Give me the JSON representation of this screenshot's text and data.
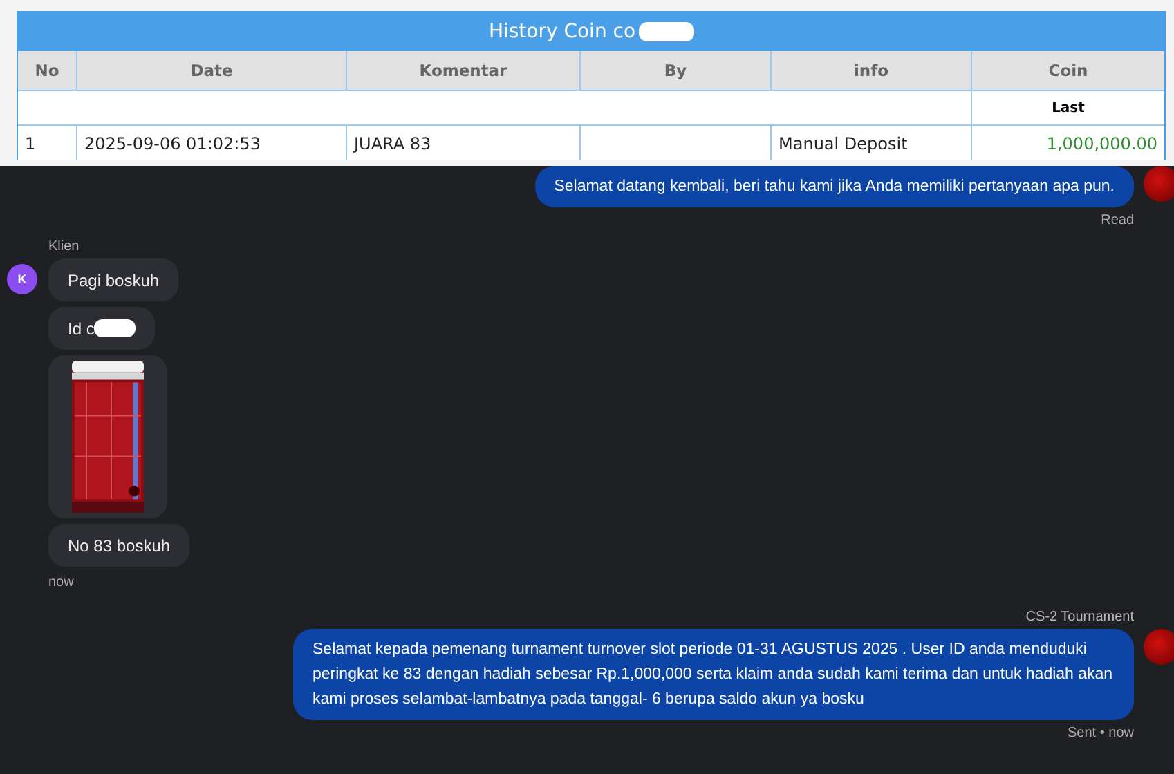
{
  "history": {
    "title": "History Coin co",
    "title_redacted": true,
    "columns": [
      "No",
      "Date",
      "Komentar",
      "By",
      "info",
      "Coin"
    ],
    "subheader": "Last",
    "rows": [
      {
        "no": "1",
        "date": "2025-09-06 01:02:53",
        "komentar": "JUARA 83",
        "info": "Manual Deposit",
        "coin": "1,000,000.00"
      }
    ]
  },
  "chat": [
    {
      "kind": "agent",
      "text": "Selamat datang kembali, beri tahu kami jika Anda memiliki pertanyaan apa pun.",
      "status": "Read"
    },
    {
      "kind": "client",
      "sender": "Klien",
      "avatar": "K",
      "time": "now",
      "messages": [
        {
          "kind": "text",
          "text": "Pagi boskuh"
        },
        {
          "kind": "text",
          "text": "Id c",
          "redacted": true
        },
        {
          "kind": "picture"
        },
        {
          "kind": "text",
          "text": "No 83 boskuh"
        }
      ]
    },
    {
      "kind": "agent",
      "sender": "CS-2 Tournament",
      "text": "Selamat kepada pemenang turnament turnover slot periode 01-31 AGUSTUS 2025 . User ID anda menduduki peringkat ke 83 dengan hadiah sebesar Rp.1,000,000 serta klaim anda sudah kami terima dan untuk hadiah akan kami proses selambat-lambatnya pada tanggal- 6 berupa saldo akun ya bosku",
      "status": "Sent • now"
    }
  ]
}
